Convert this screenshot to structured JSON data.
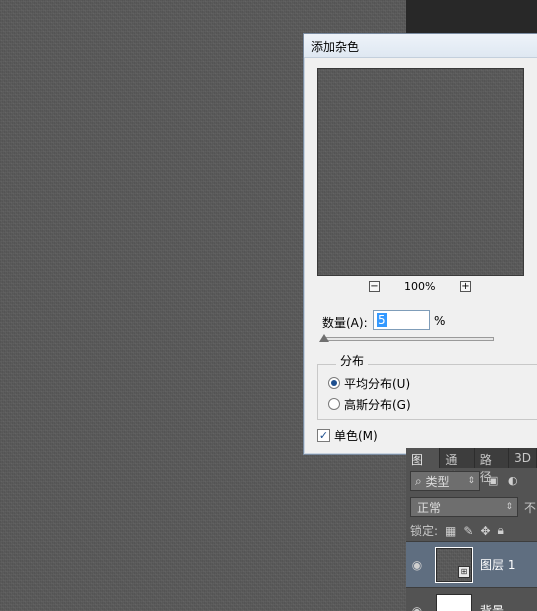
{
  "dialog": {
    "title": "添加杂色",
    "zoom_out": "−",
    "zoom_in": "+",
    "zoom_level": "100%",
    "amount_label": "数量(A):",
    "amount_value": "5",
    "amount_unit": "%",
    "distribution_legend": "分布",
    "uniform_label": "平均分布(U)",
    "gaussian_label": "高斯分布(G)",
    "selected_distribution": "uniform",
    "monochromatic_label": "单色(M)",
    "monochromatic_checked": true,
    "check_mark": "✓"
  },
  "layers_panel": {
    "tabs": [
      "图层",
      "通道",
      "路径",
      "3D"
    ],
    "filter_kind": "类型",
    "filter_arrow": "⇕",
    "blend_mode": "正常",
    "blend_arrow": "⇕",
    "opacity_label": "不",
    "lock_label": "锁定:",
    "eye_icon": "◉",
    "layers": [
      {
        "name": "图层 1",
        "selected": true,
        "badge": "⊞"
      },
      {
        "name": "背景",
        "selected": false
      }
    ]
  }
}
